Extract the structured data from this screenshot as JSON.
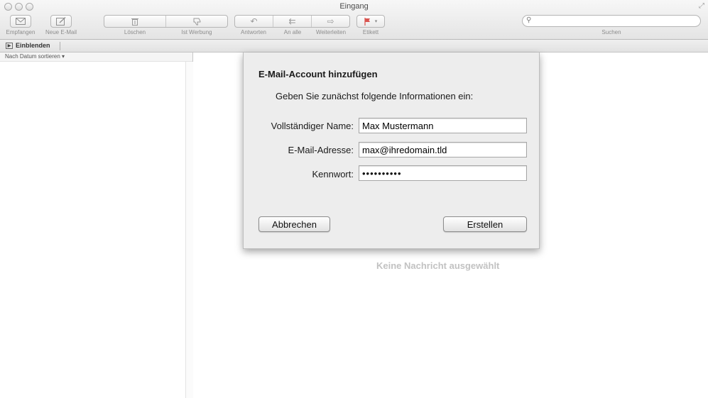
{
  "window": {
    "title": "Eingang"
  },
  "toolbar": {
    "receive_label": "Empfangen",
    "new_mail_label": "Neue E-Mail",
    "delete_label": "Löschen",
    "junk_label": "Ist Werbung",
    "reply_label": "Antworten",
    "reply_all_label": "An alle",
    "forward_label": "Weiterleiten",
    "flag_label": "Etikett",
    "search_label": "Suchen",
    "search_placeholder": ""
  },
  "favorites": {
    "show_label": "Einblenden"
  },
  "message_list": {
    "sort_label": "Nach Datum sortieren ▾"
  },
  "reading_pane": {
    "empty_text": "Keine Nachricht ausgewählt"
  },
  "dialog": {
    "title": "E-Mail-Account hinzufügen",
    "intro": "Geben Sie zunächst folgende Informationen ein:",
    "name_label": "Vollständiger Name:",
    "name_value": "Max Mustermann",
    "email_label": "E-Mail-Adresse:",
    "email_value": "max@ihredomain.tld",
    "password_label": "Kennwort:",
    "password_value": "••••••••••",
    "cancel_label": "Abbrechen",
    "create_label": "Erstellen"
  },
  "colors": {
    "flag": "#d9534f",
    "window_bg": "#ffffff",
    "sheet_bg": "#ededed"
  }
}
